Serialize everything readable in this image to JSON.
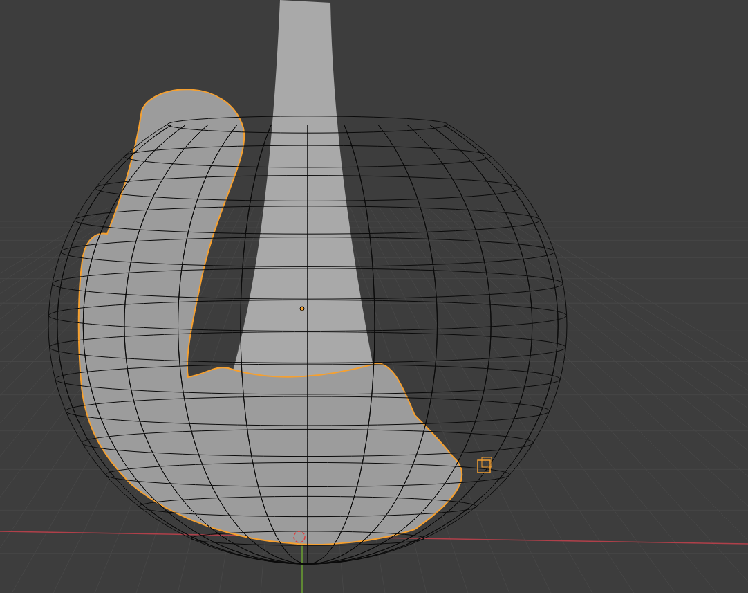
{
  "viewport": {
    "objects": [
      {
        "kind": "cone",
        "selected": false
      },
      {
        "kind": "sculpt",
        "selected": true
      },
      {
        "kind": "wire-sphere",
        "selected": false
      }
    ]
  }
}
